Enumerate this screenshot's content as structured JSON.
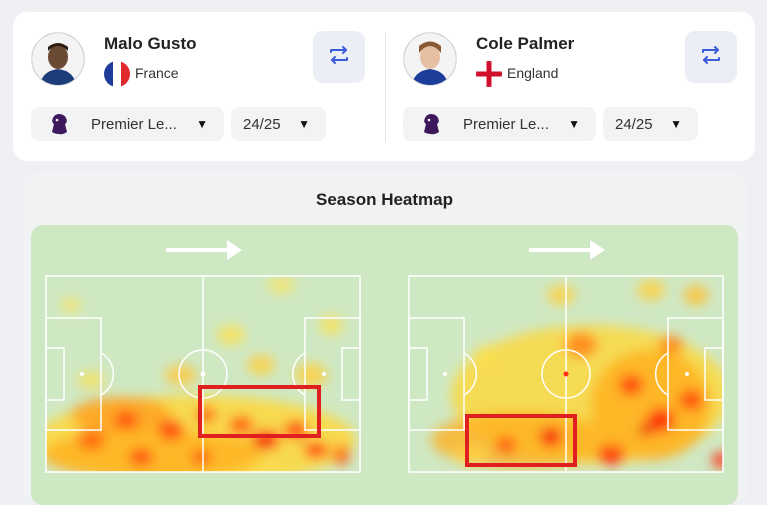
{
  "players": [
    {
      "name": "Malo Gusto",
      "country": "France",
      "flag": "france-flag",
      "league": "Premier Le...",
      "season": "24/25"
    },
    {
      "name": "Cole Palmer",
      "country": "England",
      "flag": "england-flag",
      "league": "Premier Le...",
      "season": "24/25"
    }
  ],
  "heatmap": {
    "title": "Season Heatmap"
  },
  "colors": {
    "accent": "#3b5bdb",
    "highlight_box": "#e02020",
    "pitch": "#cfe8c4"
  }
}
